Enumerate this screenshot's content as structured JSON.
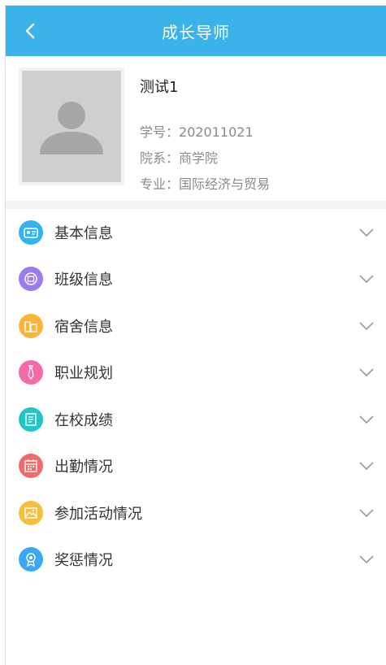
{
  "header": {
    "title": "成长导师"
  },
  "profile": {
    "name": "测试1",
    "student_id_label": "学号：",
    "student_id": "202011021",
    "department_label": "院系：",
    "department": "商学院",
    "major_label": "专业：",
    "major": "国际经济与贸易"
  },
  "menu": {
    "items": [
      {
        "label": "基本信息",
        "icon": "id-card-icon",
        "color": "#33b4f0"
      },
      {
        "label": "班级信息",
        "icon": "class-icon",
        "color": "#9b7cf0"
      },
      {
        "label": "宿舍信息",
        "icon": "building-icon",
        "color": "#f7b63a"
      },
      {
        "label": "职业规划",
        "icon": "tie-icon",
        "color": "#f56aa8"
      },
      {
        "label": "在校成绩",
        "icon": "report-icon",
        "color": "#22c5c8"
      },
      {
        "label": "出勤情况",
        "icon": "calendar-icon",
        "color": "#f06a6a"
      },
      {
        "label": "参加活动情况",
        "icon": "activity-icon",
        "color": "#f5bf3d"
      },
      {
        "label": "奖惩情况",
        "icon": "medal-icon",
        "color": "#3aa8f2"
      }
    ]
  }
}
